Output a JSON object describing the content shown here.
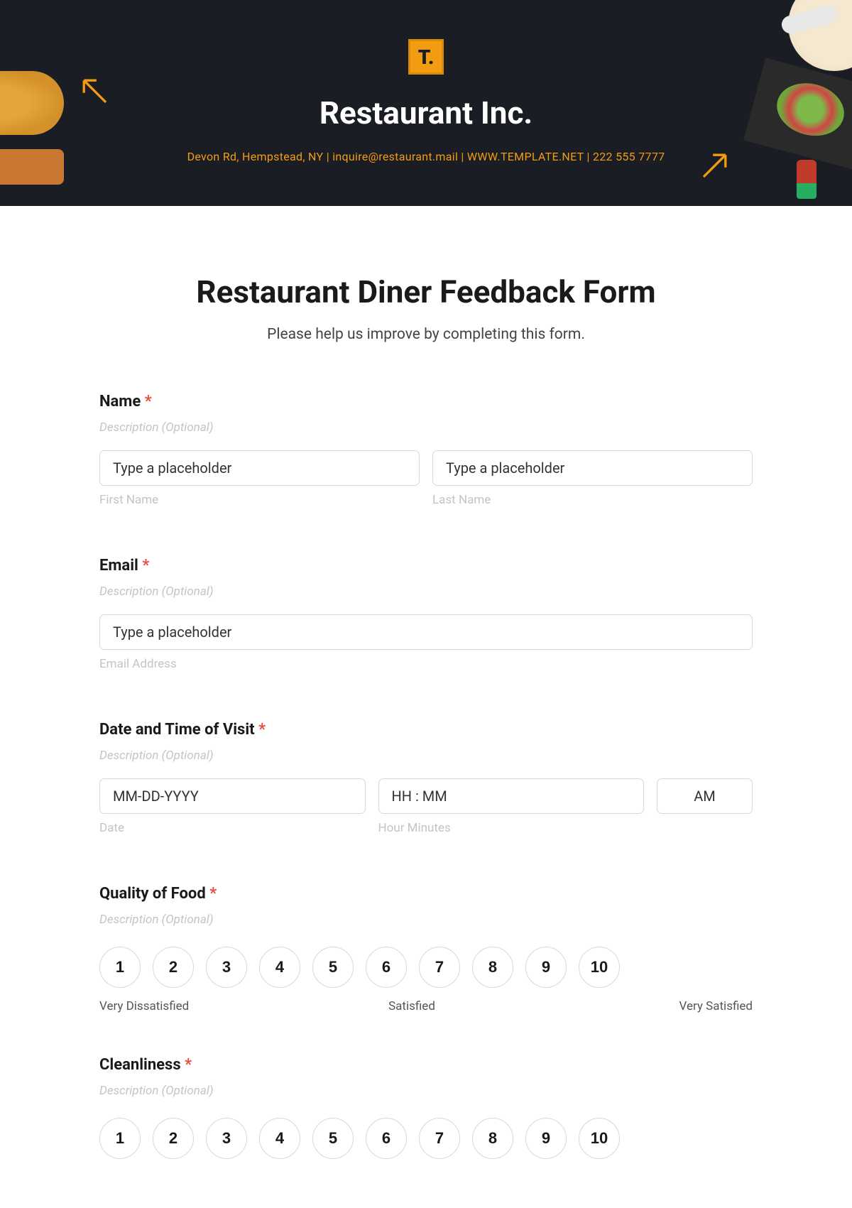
{
  "header": {
    "logo_text": "T.",
    "company_name": "Restaurant Inc.",
    "company_info": "Devon Rd, Hempstead, NY | inquire@restaurant.mail | WWW.TEMPLATE.NET | 222 555 7777"
  },
  "form": {
    "title": "Restaurant Diner Feedback Form",
    "subtitle": "Please help us improve by completing this form.",
    "desc_placeholder": "Description (Optional)",
    "name": {
      "label": "Name",
      "first_placeholder": "Type a placeholder",
      "first_sublabel": "First Name",
      "last_placeholder": "Type a placeholder",
      "last_sublabel": "Last Name"
    },
    "email": {
      "label": "Email",
      "placeholder": "Type a placeholder",
      "sublabel": "Email Address"
    },
    "datetime": {
      "label": "Date and Time of Visit",
      "date_placeholder": "MM-DD-YYYY",
      "date_sublabel": "Date",
      "time_placeholder": "HH : MM",
      "time_sublabel": "Hour Minutes",
      "ampm": "AM"
    },
    "quality": {
      "label": "Quality of Food",
      "scale_left": "Very Dissatisfied",
      "scale_mid": "Satisfied",
      "scale_right": "Very Satisfied"
    },
    "cleanliness": {
      "label": "Cleanliness"
    },
    "rating_values": [
      "1",
      "2",
      "3",
      "4",
      "5",
      "6",
      "7",
      "8",
      "9",
      "10"
    ]
  }
}
